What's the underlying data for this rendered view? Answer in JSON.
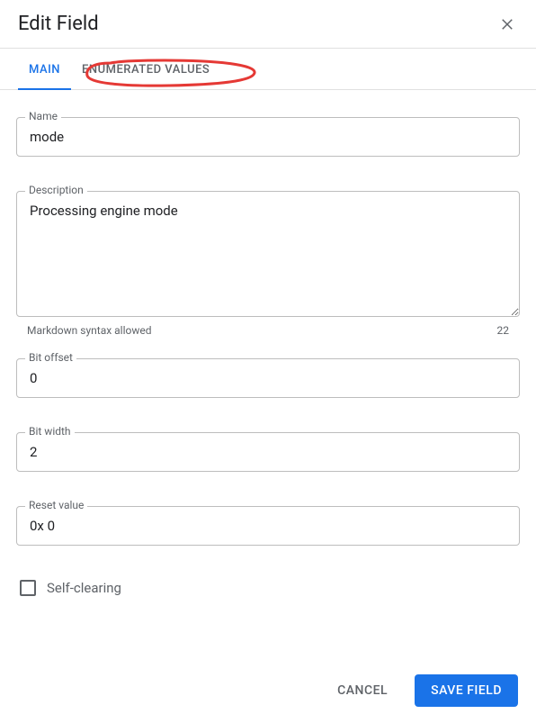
{
  "header": {
    "title": "Edit Field"
  },
  "tabs": {
    "main": "MAIN",
    "enum": "ENUMERATED VALUES"
  },
  "form": {
    "name": {
      "label": "Name",
      "value": "mode"
    },
    "description": {
      "label": "Description",
      "value": "Processing engine mode",
      "hint": "Markdown syntax allowed",
      "count": "22"
    },
    "bitOffset": {
      "label": "Bit offset",
      "value": "0"
    },
    "bitWidth": {
      "label": "Bit width",
      "value": "2"
    },
    "resetValue": {
      "label": "Reset value",
      "value": "0x 0"
    },
    "selfClearing": {
      "label": "Self-clearing",
      "checked": false
    }
  },
  "footer": {
    "cancel": "CANCEL",
    "save": "SAVE FIELD"
  }
}
